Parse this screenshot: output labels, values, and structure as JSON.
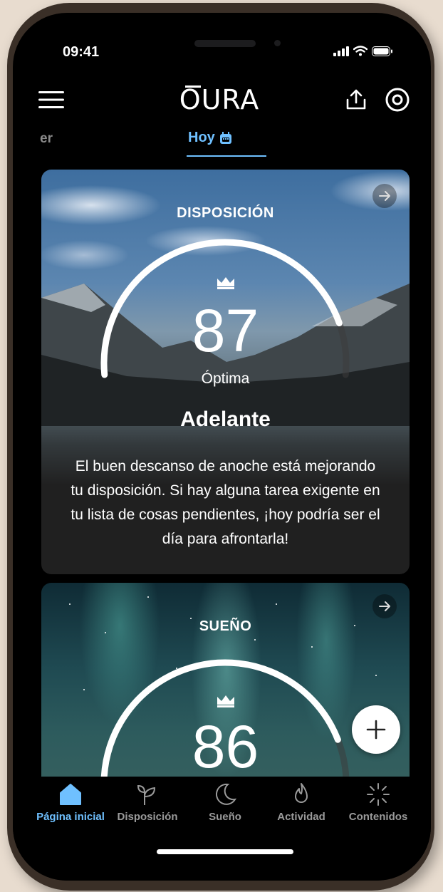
{
  "status": {
    "time": "09:41"
  },
  "header": {
    "logo": "OURA"
  },
  "date_tabs": {
    "previous_partial": "er",
    "current": "Hoy"
  },
  "readiness_card": {
    "title": "DISPOSICIÓN",
    "score": "87",
    "score_fraction": 0.87,
    "rating": "Óptima",
    "headline": "Adelante",
    "description": "El buen descanso de anoche está mejorando tu disposición. Si hay alguna tarea exigente en tu lista de cosas pendientes, ¡hoy podría ser el día para afrontarla!"
  },
  "sleep_card": {
    "title": "SUEÑO",
    "score": "86",
    "score_fraction": 0.86
  },
  "tabbar": {
    "items": [
      {
        "label": "Página inicial",
        "icon": "home-icon",
        "active": true
      },
      {
        "label": "Disposición",
        "icon": "sprout-icon",
        "active": false
      },
      {
        "label": "Sueño",
        "icon": "moon-icon",
        "active": false
      },
      {
        "label": "Actividad",
        "icon": "flame-icon",
        "active": false
      },
      {
        "label": "Contenidos",
        "icon": "sparkle-icon",
        "active": false
      }
    ]
  },
  "colors": {
    "accent": "#6fc0ff",
    "background": "#000000"
  }
}
